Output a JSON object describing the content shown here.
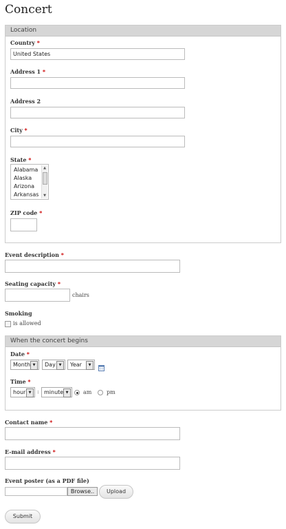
{
  "page_title": "Concert",
  "location": {
    "legend": "Location",
    "country": {
      "label": "Country",
      "value": "United States"
    },
    "address1": {
      "label": "Address 1",
      "value": ""
    },
    "address2": {
      "label": "Address 2",
      "value": ""
    },
    "city": {
      "label": "City",
      "value": ""
    },
    "state": {
      "label": "State",
      "options": [
        "Alabama",
        "Alaska",
        "Arizona",
        "Arkansas"
      ]
    },
    "zip": {
      "label": "ZIP code",
      "value": ""
    }
  },
  "required_marker": "*",
  "event_description": {
    "label": "Event description",
    "value": ""
  },
  "seating_capacity": {
    "label": "Seating capacity",
    "value": "",
    "suffix": "chairs"
  },
  "smoking": {
    "label": "Smoking",
    "checkbox_label": "is allowed",
    "checked": false
  },
  "concert_begins": {
    "legend": "When the concert begins",
    "date": {
      "label": "Date",
      "month": "Month",
      "day": "Day",
      "year": "Year"
    },
    "time": {
      "label": "Time",
      "hour": "hour",
      "separator": ":",
      "minute": "minute",
      "am": "am",
      "pm": "pm",
      "selected": "am"
    }
  },
  "contact_name": {
    "label": "Contact name",
    "value": ""
  },
  "email": {
    "label": "E-mail address",
    "value": ""
  },
  "event_poster": {
    "label": "Event poster (as a PDF file)",
    "browse_label": "Browse..",
    "upload_label": "Upload"
  },
  "submit_label": "Submit",
  "icons": {
    "dropdown": "triangle-down",
    "calendar": "calendar-icon"
  }
}
